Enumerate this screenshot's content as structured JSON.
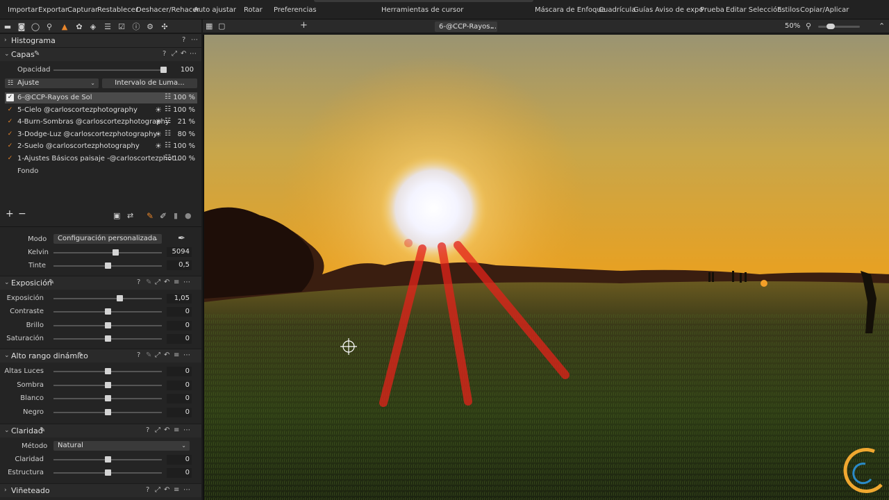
{
  "toolbar": {
    "items": [
      "Importar",
      "Exportar",
      "Capturar",
      "Restablecer",
      "Deshacer/Rehacer",
      "Auto ajustar",
      "Rotar",
      "Preferencias",
      "Herramientas de cursor",
      "Máscara de Enfoque",
      "Cuadrícula",
      "Guías",
      "Aviso de expo",
      "Prueba",
      "Editar Selección",
      "Estilos",
      "Copiar/Aplicar"
    ]
  },
  "tool_tabs": [
    "folder-icon",
    "camera-icon",
    "lens-icon",
    "search-icon",
    "layers-adjust-icon",
    "color-icon",
    "stack-icon",
    "list-icon",
    "check-icon",
    "info-icon",
    "gear-icon",
    "puzzle-icon"
  ],
  "histogram": {
    "title": "Histograma",
    "help": "?"
  },
  "layers": {
    "title": "Capas",
    "opacity_label": "Opacidad",
    "opacity_value": "100",
    "opacity_level": 1.0,
    "adjust_dropdown": "Ajuste",
    "luma_button": "Intervalo de Luma...",
    "items": [
      {
        "name": "6-@CCP-Rayos de Sol",
        "opacity": "100 %",
        "selected": true,
        "sun": false
      },
      {
        "name": "5-Cielo @carloscortezphotography",
        "opacity": "100 %",
        "selected": false,
        "sun": true
      },
      {
        "name": "4-Burn-Sombras @carloscortezphotography",
        "opacity": "21 %",
        "selected": false,
        "sun": true
      },
      {
        "name": "3-Dodge-Luz @carloscortezphotography",
        "opacity": "80 %",
        "selected": false,
        "sun": true
      },
      {
        "name": "2-Suelo @carloscortezphotography",
        "opacity": "100 %",
        "selected": false,
        "sun": true
      },
      {
        "name": "1-Ajustes Básicos paisaje -@carloscortezphot...",
        "opacity": "100 %",
        "selected": false,
        "sun": false
      }
    ],
    "background": "Fondo",
    "add": "+",
    "remove": "−"
  },
  "white_balance": {
    "mode_label": "Modo",
    "mode_value": "Configuración personalizada",
    "kelvin_label": "Kelvin",
    "kelvin_value": "5094",
    "kelvin_level": 0.58,
    "tint_label": "Tinte",
    "tint_value": "0,5",
    "tint_level": 0.5
  },
  "exposure": {
    "title": "Exposición",
    "rows": [
      {
        "label": "Exposición",
        "value": "1,05",
        "level": 0.62
      },
      {
        "label": "Contraste",
        "value": "0",
        "level": 0.5
      },
      {
        "label": "Brillo",
        "value": "0",
        "level": 0.5
      },
      {
        "label": "Saturación",
        "value": "0",
        "level": 0.5
      }
    ]
  },
  "hdr_tool": {
    "title": "Alto rango dinámico",
    "rows": [
      {
        "label": "Altas Luces",
        "value": "0",
        "level": 0.5
      },
      {
        "label": "Sombra",
        "value": "0",
        "level": 0.5
      },
      {
        "label": "Blanco",
        "value": "0",
        "level": 0.5
      },
      {
        "label": "Negro",
        "value": "0",
        "level": 0.5
      }
    ]
  },
  "clarity": {
    "title": "Claridad",
    "method_label": "Método",
    "method_value": "Natural",
    "rows": [
      {
        "label": "Claridad",
        "value": "0",
        "level": 0.5
      },
      {
        "label": "Estructura",
        "value": "0",
        "level": 0.5
      }
    ]
  },
  "vignette": {
    "title": "Viñeteado"
  },
  "viewer": {
    "variant": "6-@CCP-Rayos...",
    "zoom": "50%",
    "zoom_level": 0.25
  },
  "colors": {
    "accent": "#e8852a",
    "panel": "#242424",
    "header": "#2a2a2a"
  }
}
